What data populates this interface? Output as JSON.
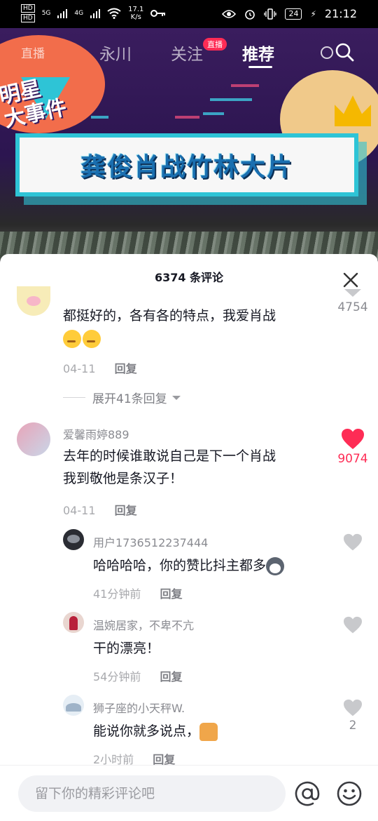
{
  "status_bar": {
    "hd_1": "HD",
    "hd_2": "HD",
    "net_1": "5G",
    "net_2": "4G",
    "speed_value": "17.1",
    "speed_unit": "K/s",
    "battery": "24",
    "time": "21:12"
  },
  "top_nav": {
    "live_label": "直播",
    "location": "永川",
    "following": "关注",
    "following_badge": "直播",
    "recommended": "推荐"
  },
  "video": {
    "corner_text_1": "明星",
    "corner_text_2": "大事件",
    "banner_text": "龚俊肖战竹林大片"
  },
  "comments_sheet": {
    "title": "6374 条评论",
    "comments": [
      {
        "author": "",
        "text": "都挺好的，各有各的特点，我爱肖战",
        "date": "04-11",
        "reply_label": "回复",
        "likes": "4754",
        "liked": false
      },
      {
        "author": "爱馨雨婷889",
        "text_line1": "去年的时候谁敢说自己是下一个肖战",
        "text_line2": "我到敬他是条汉子！",
        "date": "04-11",
        "reply_label": "回复",
        "likes": "9074",
        "liked": true
      }
    ],
    "expand_replies": "展开41条回复",
    "replies": [
      {
        "author": "用户1736512237444",
        "text": "哈哈哈哈，你的赞比抖主都多",
        "time": "41分钟前",
        "reply_label": "回复",
        "likes": ""
      },
      {
        "author": "温婉居家，不卑不亢",
        "text": "干的漂亮！",
        "time": "54分钟前",
        "reply_label": "回复",
        "likes": ""
      },
      {
        "author": "狮子座的小天秤W.",
        "text": "能说你就多说点，",
        "time": "2小时前",
        "reply_label": "回复",
        "likes": "2"
      }
    ]
  },
  "input": {
    "placeholder": "留下你的精彩评论吧"
  },
  "colors": {
    "accent_red": "#fe2c55",
    "liked_heart": "#fe2c55",
    "unliked_heart": "#c8c9cc",
    "banner_cyan": "#2ec4d6"
  }
}
